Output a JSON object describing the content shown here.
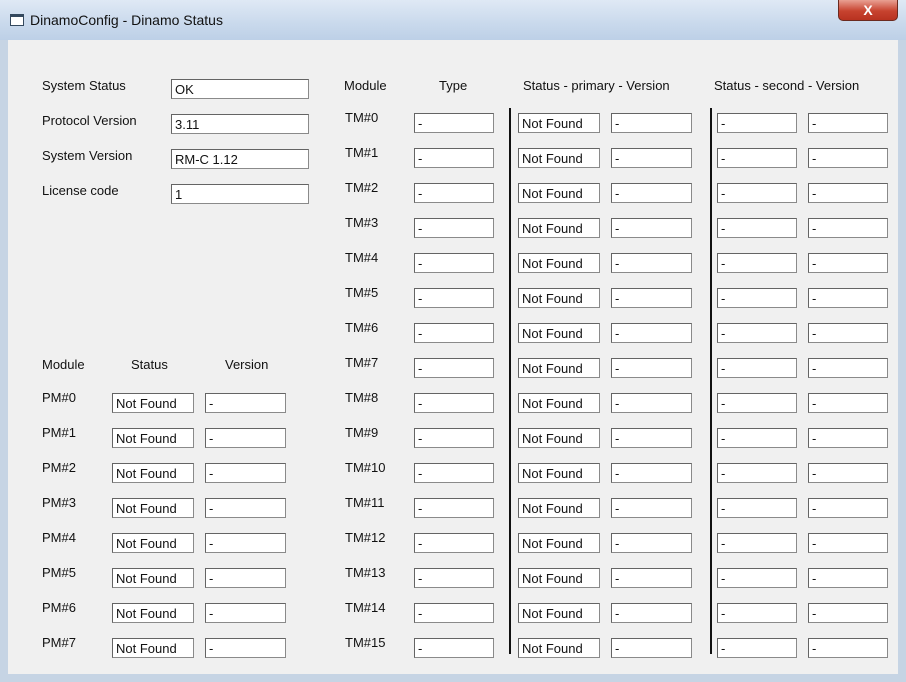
{
  "window": {
    "title": "DinamoConfig - Dinamo Status",
    "close_label": "X"
  },
  "system": [
    {
      "label": "System Status",
      "value": "OK"
    },
    {
      "label": "Protocol Version",
      "value": "3.11"
    },
    {
      "label": "System Version",
      "value": "RM-C 1.12"
    },
    {
      "label": "License code",
      "value": "1"
    }
  ],
  "pm_headers": {
    "module": "Module",
    "status": "Status",
    "version": "Version"
  },
  "pm_rows": [
    {
      "name": "PM#0",
      "status": "Not Found",
      "version": "-"
    },
    {
      "name": "PM#1",
      "status": "Not Found",
      "version": "-"
    },
    {
      "name": "PM#2",
      "status": "Not Found",
      "version": "-"
    },
    {
      "name": "PM#3",
      "status": "Not Found",
      "version": "-"
    },
    {
      "name": "PM#4",
      "status": "Not Found",
      "version": "-"
    },
    {
      "name": "PM#5",
      "status": "Not Found",
      "version": "-"
    },
    {
      "name": "PM#6",
      "status": "Not Found",
      "version": "-"
    },
    {
      "name": "PM#7",
      "status": "Not Found",
      "version": "-"
    }
  ],
  "tm_headers": {
    "module": "Module",
    "type": "Type",
    "primary": "Status - primary - Version",
    "second": "Status - second - Version"
  },
  "tm_rows": [
    {
      "name": "TM#0",
      "type": "-",
      "primary_status": "Not Found",
      "primary_version": "-",
      "second_status": "-",
      "second_version": "-"
    },
    {
      "name": "TM#1",
      "type": "-",
      "primary_status": "Not Found",
      "primary_version": "-",
      "second_status": "-",
      "second_version": "-"
    },
    {
      "name": "TM#2",
      "type": "-",
      "primary_status": "Not Found",
      "primary_version": "-",
      "second_status": "-",
      "second_version": "-"
    },
    {
      "name": "TM#3",
      "type": "-",
      "primary_status": "Not Found",
      "primary_version": "-",
      "second_status": "-",
      "second_version": "-"
    },
    {
      "name": "TM#4",
      "type": "-",
      "primary_status": "Not Found",
      "primary_version": "-",
      "second_status": "-",
      "second_version": "-"
    },
    {
      "name": "TM#5",
      "type": "-",
      "primary_status": "Not Found",
      "primary_version": "-",
      "second_status": "-",
      "second_version": "-"
    },
    {
      "name": "TM#6",
      "type": "-",
      "primary_status": "Not Found",
      "primary_version": "-",
      "second_status": "-",
      "second_version": "-"
    },
    {
      "name": "TM#7",
      "type": "-",
      "primary_status": "Not Found",
      "primary_version": "-",
      "second_status": "-",
      "second_version": "-"
    },
    {
      "name": "TM#8",
      "type": "-",
      "primary_status": "Not Found",
      "primary_version": "-",
      "second_status": "-",
      "second_version": "-"
    },
    {
      "name": "TM#9",
      "type": "-",
      "primary_status": "Not Found",
      "primary_version": "-",
      "second_status": "-",
      "second_version": "-"
    },
    {
      "name": "TM#10",
      "type": "-",
      "primary_status": "Not Found",
      "primary_version": "-",
      "second_status": "-",
      "second_version": "-"
    },
    {
      "name": "TM#11",
      "type": "-",
      "primary_status": "Not Found",
      "primary_version": "-",
      "second_status": "-",
      "second_version": "-"
    },
    {
      "name": "TM#12",
      "type": "-",
      "primary_status": "Not Found",
      "primary_version": "-",
      "second_status": "-",
      "second_version": "-"
    },
    {
      "name": "TM#13",
      "type": "-",
      "primary_status": "Not Found",
      "primary_version": "-",
      "second_status": "-",
      "second_version": "-"
    },
    {
      "name": "TM#14",
      "type": "-",
      "primary_status": "Not Found",
      "primary_version": "-",
      "second_status": "-",
      "second_version": "-"
    },
    {
      "name": "TM#15",
      "type": "-",
      "primary_status": "Not Found",
      "primary_version": "-",
      "second_status": "-",
      "second_version": "-"
    }
  ]
}
